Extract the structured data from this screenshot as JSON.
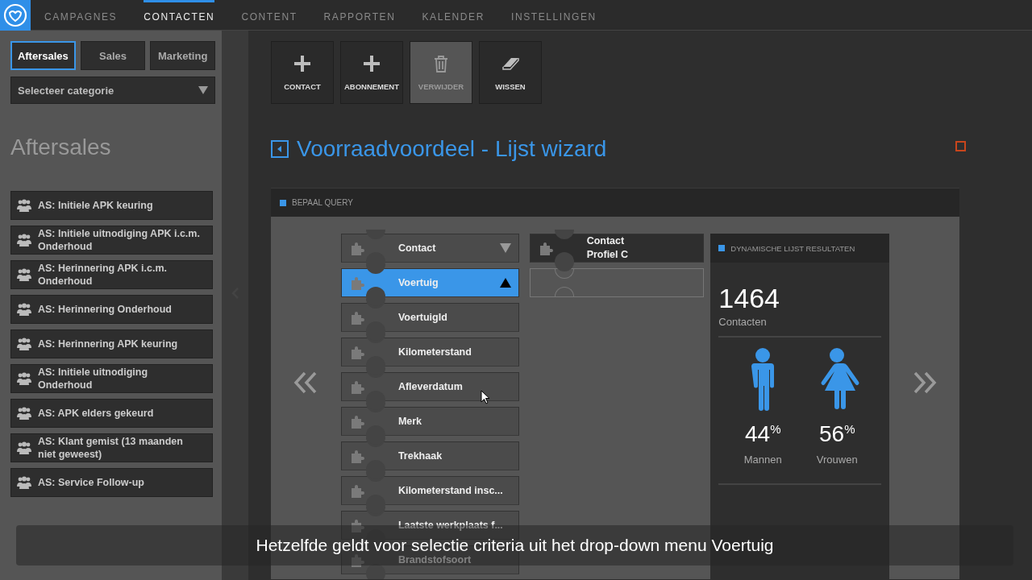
{
  "nav": {
    "tabs": [
      {
        "label": "CAMPAGNES",
        "selected": false
      },
      {
        "label": "CONTACTEN",
        "selected": true
      },
      {
        "label": "CONTENT",
        "selected": false
      },
      {
        "label": "RAPPORTEN",
        "selected": false
      },
      {
        "label": "KALENDER",
        "selected": false
      },
      {
        "label": "INSTELLINGEN",
        "selected": false
      }
    ]
  },
  "sidebar": {
    "tabs": [
      {
        "label": "Aftersales",
        "selected": true
      },
      {
        "label": "Sales",
        "selected": false
      },
      {
        "label": "Marketing",
        "selected": false
      }
    ],
    "category_select": {
      "placeholder": "Selecteer categorie"
    },
    "heading": "Aftersales",
    "items": [
      {
        "label": "AS: Initiele APK keuring"
      },
      {
        "label": "AS: Initiele uitnodiging APK i.c.m. Onderhoud"
      },
      {
        "label": "AS: Herinnering APK i.c.m. Onderhoud"
      },
      {
        "label": "AS: Herinnering Onderhoud"
      },
      {
        "label": "AS: Herinnering APK keuring"
      },
      {
        "label": "AS: Initiele uitnodiging Onderhoud"
      },
      {
        "label": "AS: APK elders gekeurd"
      },
      {
        "label": "AS: Klant gemist (13 maanden niet geweest)"
      },
      {
        "label": "AS: Service Follow-up"
      }
    ]
  },
  "toolbar": [
    {
      "label": "CONTACT",
      "kind": "plus",
      "disabled": false
    },
    {
      "label": "ABONNEMENT",
      "kind": "plus",
      "disabled": false
    },
    {
      "label": "VERWIJDER",
      "kind": "trash",
      "disabled": true
    },
    {
      "label": "WISSEN",
      "kind": "eraser",
      "disabled": false
    }
  ],
  "title": "Voorraadvoordeel - Lijst wizard",
  "query_panel": {
    "header": "BEPAAL QUERY",
    "criteria": [
      {
        "label": "Contact",
        "kind": "group",
        "expanded": false,
        "selected": false
      },
      {
        "label": "Voertuig",
        "kind": "group",
        "expanded": true,
        "selected": true
      },
      {
        "label": "VoertuigId",
        "kind": "field",
        "selected": false
      },
      {
        "label": "Kilometerstand",
        "kind": "field",
        "selected": false
      },
      {
        "label": "Afleverdatum",
        "kind": "field",
        "selected": false
      },
      {
        "label": "Merk",
        "kind": "field",
        "selected": false
      },
      {
        "label": "Trekhaak",
        "kind": "field",
        "selected": false
      },
      {
        "label": "Kilometerstand insc...",
        "kind": "field",
        "selected": false
      },
      {
        "label": "Laatste werkplaats f...",
        "kind": "field",
        "selected": false
      },
      {
        "label": "Brandstofsoort",
        "kind": "field",
        "selected": false
      }
    ],
    "query": [
      {
        "lines": [
          "Contact",
          "Profiel C"
        ]
      }
    ],
    "results": {
      "header": "DYNAMISCHE LIJST RESULTATEN",
      "count": "1464",
      "count_label": "Contacten",
      "genders": [
        {
          "kind": "male",
          "percent": "44",
          "unit": "%",
          "label": "Mannen"
        },
        {
          "kind": "female",
          "percent": "56",
          "unit": "%",
          "label": "Vrouwen"
        }
      ]
    }
  },
  "caption": "Hetzelfde geldt voor selectie criteria uit het drop-down menu Voertuig"
}
